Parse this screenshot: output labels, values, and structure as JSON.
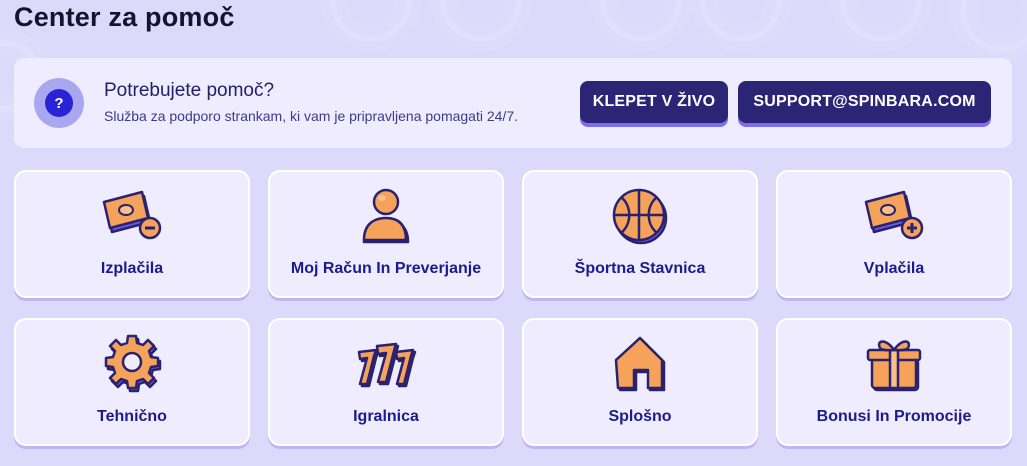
{
  "page": {
    "title": "Center za pomoč"
  },
  "help": {
    "heading": "Potrebujete pomoč?",
    "subtitle": "Služba za podporo strankam, ki vam je pripravljena pomagati 24/7.",
    "icon": "question-icon",
    "icon_glyph": "?",
    "chat_button": "KLEPET V ŽIVO",
    "email_button": "SUPPORT@SPINBARA.COM"
  },
  "categories": [
    {
      "label": "Izplačila",
      "icon": "withdrawal-icon"
    },
    {
      "label": "Moj Račun In Preverjanje",
      "icon": "user-icon"
    },
    {
      "label": "Športna Stavnica",
      "icon": "basketball-icon"
    },
    {
      "label": "Vplačila",
      "icon": "deposit-icon"
    },
    {
      "label": "Tehnično",
      "icon": "gear-icon"
    },
    {
      "label": "Igralnica",
      "icon": "slot-777-icon"
    },
    {
      "label": "Splošno",
      "icon": "home-icon"
    },
    {
      "label": "Bonusi In Promocije",
      "icon": "gift-icon"
    }
  ],
  "colors": {
    "background": "#ddd9fb",
    "panel": "#eeecfe",
    "button": "#2c2576",
    "label": "#1e1a8c",
    "icon_orange": "#f5a25a",
    "icon_outline": "#2a2170"
  }
}
